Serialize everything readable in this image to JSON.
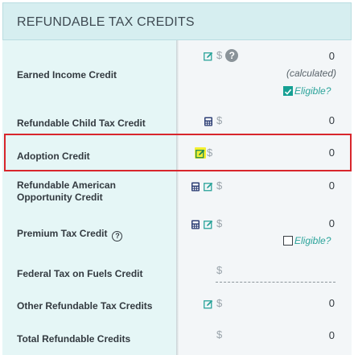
{
  "header": {
    "title": "REFUNDABLE TAX CREDITS"
  },
  "rows": {
    "earned_income": {
      "label": "Earned Income Credit",
      "value": "0",
      "note": "(calculated)",
      "eligible_label": "Eligible?",
      "eligible_checked": true,
      "help_symbol": "?"
    },
    "child_tax": {
      "label": "Refundable Child Tax Credit",
      "value": "0"
    },
    "adoption": {
      "label": "Adoption Credit",
      "value": "0"
    },
    "aoc": {
      "label_line1": "Refundable American",
      "label_line2": "Opportunity Credit",
      "value": "0"
    },
    "premium": {
      "label": "Premium Tax Credit",
      "help_symbol": "?",
      "value": "0",
      "eligible_label": "Eligible?",
      "eligible_checked": false
    },
    "fuels": {
      "label": "Federal Tax on Fuels Credit"
    },
    "other": {
      "label": "Other Refundable Tax Credits",
      "value": "0"
    },
    "total": {
      "label": "Total Refundable Credits",
      "value": "0"
    }
  },
  "currency_symbol": "$",
  "colors": {
    "accent": "#16a094",
    "icon_teal": "#2aa39a",
    "icon_navy": "#2d3f75",
    "highlight_border": "#d8262c",
    "highlight_yellow": "#f4f030"
  },
  "icons": {
    "edit": "edit-icon",
    "calculator": "calculator-icon",
    "help": "help-icon"
  }
}
